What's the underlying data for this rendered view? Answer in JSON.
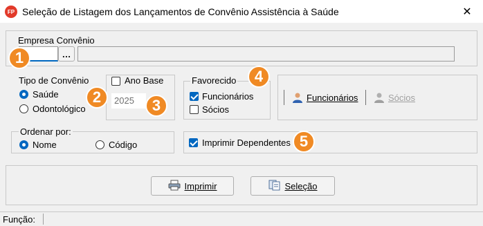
{
  "window": {
    "title": "Seleção de Listagem dos Lançamentos de Convênio Assistência à Saúde",
    "icon_text": "FP",
    "close_label": "✕"
  },
  "empresa": {
    "group_label": "Empresa Convênio",
    "code_value": "",
    "name_value": "",
    "browse_label": "…"
  },
  "tipo": {
    "group_label": "Tipo de Convênio",
    "options": [
      "Saúde",
      "Odontológico"
    ],
    "selected": "Saúde"
  },
  "ano": {
    "checkbox_label": "Ano Base",
    "checked": false,
    "value": "2025"
  },
  "favorecido": {
    "group_label": "Favorecido",
    "options": [
      "Funcionários",
      "Sócios"
    ],
    "checked": [
      true,
      false
    ]
  },
  "tabs": {
    "funcionarios_label": "Funcionários",
    "socios_label": "Sócios"
  },
  "ordenar": {
    "group_label": "Ordenar por:",
    "options": [
      "Nome",
      "Código"
    ],
    "selected": "Nome"
  },
  "dependentes": {
    "label": "Imprimir Dependentes",
    "checked": true
  },
  "actions": {
    "imprimir_label": "Imprimir",
    "selecao_label": "Seleção"
  },
  "status": {
    "funcao_label": "Função:"
  },
  "badges": [
    "1",
    "2",
    "3",
    "4",
    "5"
  ],
  "colors": {
    "accent": "#0067c0",
    "badge": "#f08a24",
    "app_icon": "#e23a2a"
  }
}
